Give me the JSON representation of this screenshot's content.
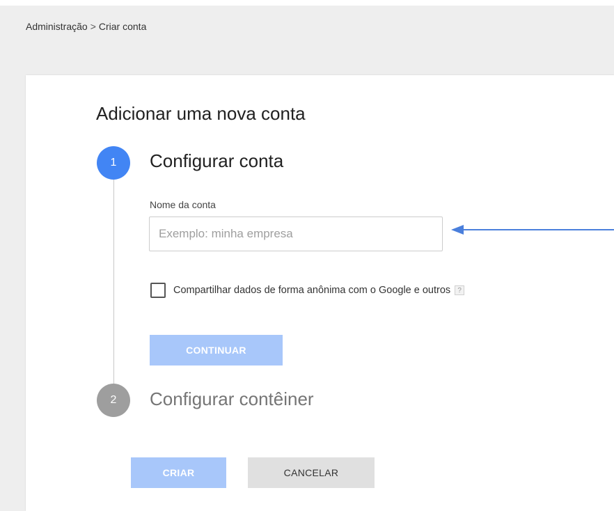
{
  "breadcrumb": {
    "items": [
      "Administração",
      "Criar conta"
    ],
    "separator": ">"
  },
  "page": {
    "title": "Adicionar uma nova conta"
  },
  "steps": [
    {
      "number": "1",
      "title": "Configurar conta",
      "state": "active"
    },
    {
      "number": "2",
      "title": "Configurar contêiner",
      "state": "inactive"
    }
  ],
  "account_form": {
    "name_label": "Nome da conta",
    "name_placeholder": "Exemplo: minha empresa",
    "name_value": "",
    "share_data_label": "Compartilhar dados de forma anônima com o Google e outros",
    "share_data_checked": false,
    "help_icon_glyph": "?",
    "continue_label": "CONTINUAR"
  },
  "actions": {
    "create_label": "CRIAR",
    "cancel_label": "CANCELAR"
  },
  "icons": {
    "help": "help-icon",
    "annotation_arrow": "arrow-left-icon"
  },
  "colors": {
    "primary": "#4285f4",
    "primary_disabled": "#a8c7fa",
    "inactive_step": "#9e9e9e",
    "annotation_arrow": "#4a7fdc"
  }
}
